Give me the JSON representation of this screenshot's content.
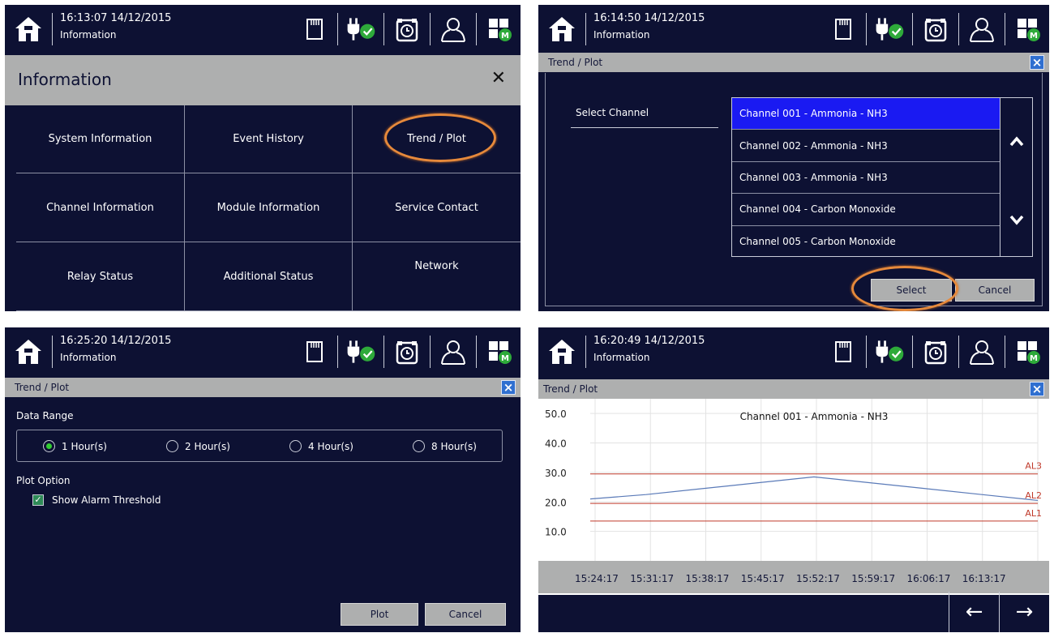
{
  "panels": [
    {
      "time": "16:13:07  14/12/2015",
      "subtitle": "Information"
    },
    {
      "time": "16:14:50  14/12/2015",
      "subtitle": "Information"
    },
    {
      "time": "16:25:20  14/12/2015",
      "subtitle": "Information"
    },
    {
      "time": "16:20:49  14/12/2015",
      "subtitle": "Information"
    }
  ],
  "info_menu": {
    "title": "Information",
    "close_label": "✕",
    "items": [
      "System Information",
      "Event History",
      "Trend / Plot",
      "Channel Information",
      "Module Information",
      "Service Contact",
      "Relay Status",
      "Additional Status",
      "Network"
    ]
  },
  "select_dialog": {
    "title": "Trend / Plot",
    "label": "Select Channel",
    "channels": [
      "Channel 001 - Ammonia - NH3",
      "Channel 002 - Ammonia - NH3",
      "Channel 003 - Ammonia - NH3",
      "Channel 004 - Carbon Monoxide",
      "Channel 005 - Carbon Monoxide"
    ],
    "selected_index": 0,
    "select_label": "Select",
    "cancel_label": "Cancel"
  },
  "options_dialog": {
    "title": "Trend / Plot",
    "range_label": "Data Range",
    "ranges": [
      "1 Hour(s)",
      "2 Hour(s)",
      "4 Hour(s)",
      "8 Hour(s)"
    ],
    "selected_range": 0,
    "plot_option_label": "Plot Option",
    "alarm_label": "Show Alarm Threshold",
    "alarm_checked": true,
    "plot_label": "Plot",
    "cancel_label": "Cancel"
  },
  "plot_view": {
    "title": "Trend / Plot",
    "prev_label": "←",
    "next_label": "→"
  },
  "colors": {
    "background": "#0d1133",
    "bar": "#aeafaf",
    "selected": "#1a1af2",
    "highlight_ring": "#e6893b",
    "threshold": "#c03a2b",
    "trend": "#5a7ab8"
  },
  "chart_data": {
    "type": "line",
    "title": "Channel 001 - Ammonia - NH3",
    "x": [
      "15:24:17",
      "15:31:17",
      "15:38:17",
      "15:45:17",
      "15:52:17",
      "15:59:17",
      "16:06:17",
      "16:13:17"
    ],
    "series": [
      {
        "values": [
          21.0,
          22.5,
          24.5,
          26.5,
          28.5,
          26.5,
          24.5,
          22.5,
          20.5
        ]
      }
    ],
    "thresholds": [
      {
        "name": "AL1",
        "value": 13.5
      },
      {
        "name": "AL2",
        "value": 19.5
      },
      {
        "name": "AL3",
        "value": 29.5
      }
    ],
    "y_ticks": [
      "50.0",
      "40.0",
      "30.0",
      "20.0",
      "10.0"
    ],
    "ylim": [
      0,
      55
    ],
    "grid": true
  }
}
